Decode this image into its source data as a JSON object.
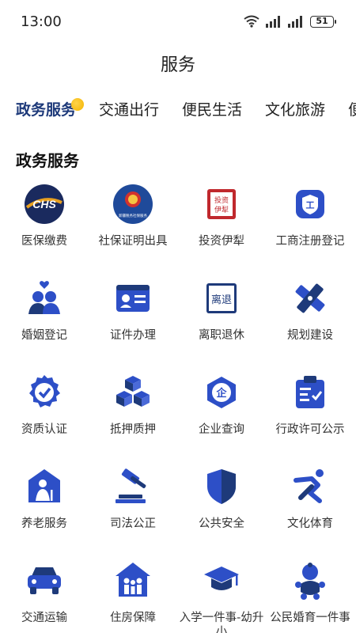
{
  "status_bar": {
    "time": "13:00",
    "battery": "51"
  },
  "page": {
    "title": "服务"
  },
  "tabs": [
    {
      "label": "政务服务",
      "active": true
    },
    {
      "label": "交通出行",
      "active": false
    },
    {
      "label": "便民生活",
      "active": false
    },
    {
      "label": "文化旅游",
      "active": false
    },
    {
      "label": "便",
      "active": false
    }
  ],
  "section": {
    "title": "政务服务"
  },
  "services": [
    {
      "label": "医保缴费",
      "icon": "chs-medical-insurance-icon",
      "icon_text": "CHS"
    },
    {
      "label": "社保证明出具",
      "icon": "social-security-emblem-icon",
      "icon_text": "新疆税务社保服务"
    },
    {
      "label": "投资伊犁",
      "icon": "invest-yili-seal-icon",
      "icon_text": "投资伊犁"
    },
    {
      "label": "工商注册登记",
      "icon": "business-registration-icon",
      "icon_text": "工"
    },
    {
      "label": "婚姻登记",
      "icon": "marriage-couple-icon"
    },
    {
      "label": "证件办理",
      "icon": "id-card-icon"
    },
    {
      "label": "离职退休",
      "icon": "retirement-seal-icon",
      "icon_text": "离退"
    },
    {
      "label": "规划建设",
      "icon": "ruler-pencil-icon"
    },
    {
      "label": "资质认证",
      "icon": "certification-check-icon"
    },
    {
      "label": "抵押质押",
      "icon": "boxes-stack-icon"
    },
    {
      "label": "企业查询",
      "icon": "enterprise-hexagon-icon",
      "icon_text": "企"
    },
    {
      "label": "行政许可公示",
      "icon": "clipboard-check-icon"
    },
    {
      "label": "养老服务",
      "icon": "elderly-house-icon"
    },
    {
      "label": "司法公正",
      "icon": "gavel-icon"
    },
    {
      "label": "公共安全",
      "icon": "shield-icon"
    },
    {
      "label": "文化体育",
      "icon": "running-person-icon"
    },
    {
      "label": "交通运输",
      "icon": "car-icon"
    },
    {
      "label": "住房保障",
      "icon": "house-family-icon"
    },
    {
      "label": "入学一件事-幼升小",
      "icon": "graduation-cap-icon"
    },
    {
      "label": "公民婚育一件事",
      "icon": "baby-icon"
    }
  ],
  "colors": {
    "primary_blue": "#2d4fc7",
    "dark_navy": "#1e3a7a",
    "accent_yellow": "#f4b400",
    "seal_red": "#c0282d"
  }
}
